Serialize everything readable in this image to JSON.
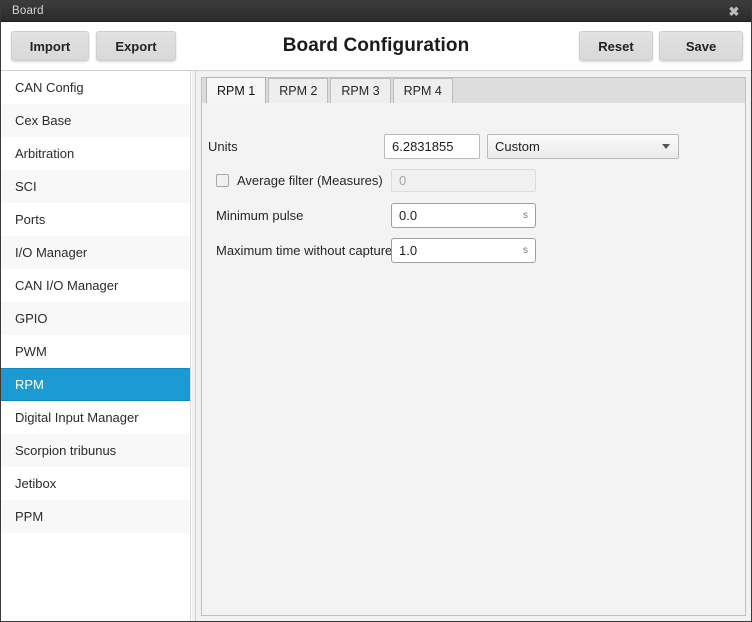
{
  "titlebar": {
    "title": "Board",
    "close_label": "✖"
  },
  "header": {
    "title": "Board Configuration",
    "import_label": "Import",
    "export_label": "Export",
    "reset_label": "Reset",
    "save_label": "Save"
  },
  "sidebar": {
    "items": [
      {
        "label": "CAN Config",
        "active": false
      },
      {
        "label": "Cex Base",
        "active": false
      },
      {
        "label": "Arbitration",
        "active": false
      },
      {
        "label": "SCI",
        "active": false
      },
      {
        "label": "Ports",
        "active": false
      },
      {
        "label": "I/O Manager",
        "active": false
      },
      {
        "label": "CAN I/O Manager",
        "active": false
      },
      {
        "label": "GPIO",
        "active": false
      },
      {
        "label": "PWM",
        "active": false
      },
      {
        "label": "RPM",
        "active": true
      },
      {
        "label": "Digital Input Manager",
        "active": false
      },
      {
        "label": "Scorpion tribunus",
        "active": false
      },
      {
        "label": "Jetibox",
        "active": false
      },
      {
        "label": "PPM",
        "active": false
      }
    ]
  },
  "main": {
    "tabs": [
      {
        "label": "RPM 1",
        "active": true
      },
      {
        "label": "RPM 2",
        "active": false
      },
      {
        "label": "RPM 3",
        "active": false
      },
      {
        "label": "RPM 4",
        "active": false
      }
    ],
    "form": {
      "units": {
        "label": "Units",
        "value": "6.2831855",
        "preset": "Custom"
      },
      "average_filter": {
        "label": "Average filter (Measures)",
        "checked": false,
        "value": "",
        "placeholder": "0"
      },
      "minimum_pulse": {
        "label": "Minimum pulse",
        "value": "0.0",
        "unit": "s"
      },
      "maximum_time": {
        "label": "Maximum time without capture",
        "value": "1.0",
        "unit": "s"
      }
    }
  },
  "colors": {
    "accent": "#1b9ad4",
    "titlebar": "#333333",
    "panel": "#f3f3f3"
  }
}
